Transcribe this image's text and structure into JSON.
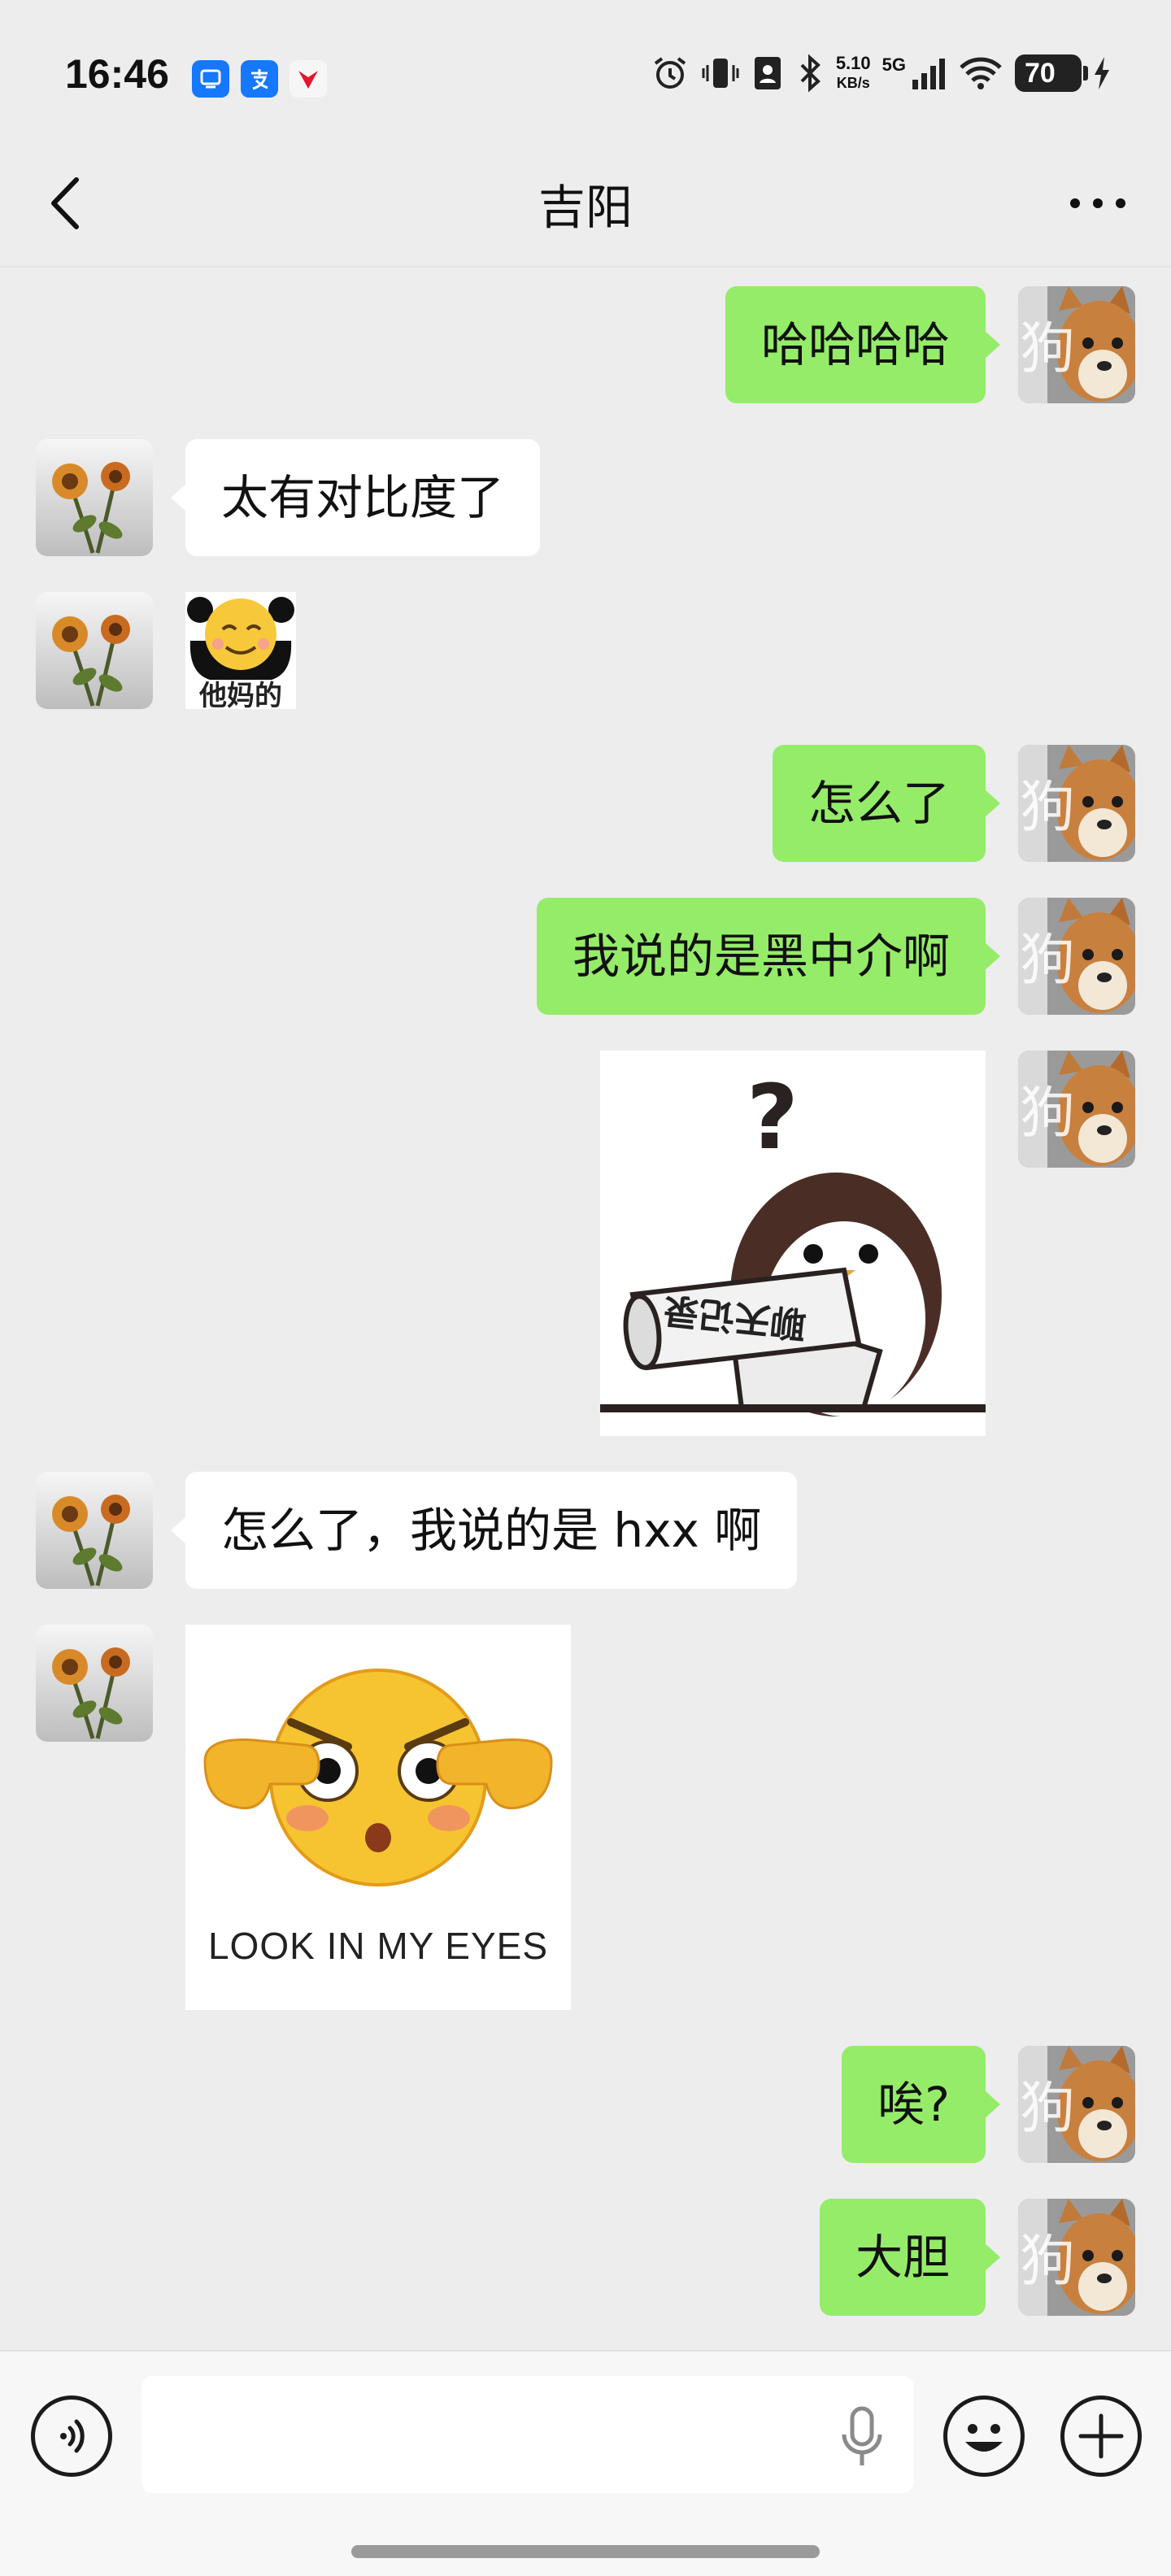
{
  "status_bar": {
    "time": "16:46",
    "net_speed_value": "5.10",
    "net_speed_unit": "KB/s",
    "network": "5G",
    "battery": "70"
  },
  "header": {
    "title": "吉阳",
    "back_icon": "chevron-left-icon",
    "more_icon": "more-horizontal-icon"
  },
  "messages": [
    {
      "sender": "me",
      "type": "text",
      "text": "哈哈哈哈"
    },
    {
      "sender": "them",
      "type": "text",
      "text": "太有对比度了"
    },
    {
      "sender": "them",
      "type": "sticker",
      "caption": "他妈的"
    },
    {
      "sender": "me",
      "type": "text",
      "text": "怎么了"
    },
    {
      "sender": "me",
      "type": "text",
      "text": "我说的是黑中介啊"
    },
    {
      "sender": "me",
      "type": "sticker",
      "caption": "聊天记录"
    },
    {
      "sender": "them",
      "type": "text",
      "text": "怎么了，我说的是 hxx 啊"
    },
    {
      "sender": "them",
      "type": "sticker",
      "caption": "LOOK IN MY EYES"
    },
    {
      "sender": "me",
      "type": "text",
      "text": "唉?"
    },
    {
      "sender": "me",
      "type": "text",
      "text": "大胆"
    }
  ],
  "avatar_overlay_char": "狗",
  "input_bar": {
    "value": "",
    "placeholder": ""
  },
  "colors": {
    "background": "#ededed",
    "my_bubble": "#95ec69",
    "their_bubble": "#ffffff"
  }
}
